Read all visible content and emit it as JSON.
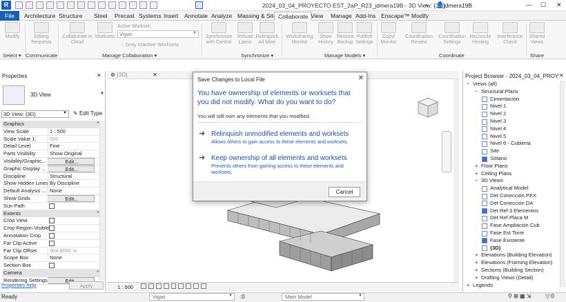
{
  "title_bar": {
    "app_letter": "R",
    "title": "2024_03_04_PROYECTO EST_2aP_R23_jdmera19B - 3D View: {3D}",
    "user": "jdmera19B",
    "minimize": "—",
    "maximize": "☐",
    "close": "✕"
  },
  "menu": {
    "file": "File",
    "tabs": [
      "Architecture",
      "Structure",
      "Steel",
      "Precast",
      "Systems",
      "Insert",
      "Annotate",
      "Analyze",
      "Massing & Site",
      "Collaborate",
      "View",
      "Manage",
      "Add-Ins",
      "Enscape™",
      "Modify"
    ],
    "active_tab": "Collaborate"
  },
  "ribbon": {
    "modify": "Modify",
    "editing_requests": "Editing\nRequests",
    "collab_cloud": "Collaborate in\nCloud",
    "worksets": "Worksets",
    "active_workset_label": "Active Workset:",
    "active_workset_value": "Vigas",
    "gray_inactive": "Gray Inactive Worksets",
    "sync_central": "Synchronize\nwith Central",
    "reload_latest": "Reload\nLatest",
    "relinquish_all": "Relinquish\nAll Mine",
    "worksharing_monitor": "Worksharing\nMonitor",
    "show_history": "Show\nHistory",
    "restore_backup": "Restore\nBackup",
    "publish_settings": "Publish\nSettings",
    "copy_monitor": "Copy/\nMonitor",
    "coordination_review": "Coordination\nReview",
    "coordination_settings": "Coordination\nSettings",
    "reconcile_hosting": "Reconcile\nHosting",
    "interference_check": "Interference\nCheck",
    "shared_views": "Shared\nViews",
    "groups": [
      "Select ▾",
      "Communicate",
      "Manage Collaboration ▾",
      "Synchronize ▾",
      "Manage Models ▾",
      "Coordinate",
      "Share"
    ]
  },
  "properties": {
    "header": "Properties",
    "type_name": "3D View",
    "view_selector": "3D View: {3D}",
    "edit_type": "Edit Type",
    "rows": [
      {
        "k": "Graphics",
        "cat": true
      },
      {
        "k": "View Scale",
        "v": "1 : 500"
      },
      {
        "k": "Scale Value 1:",
        "v": "500",
        "gray": true
      },
      {
        "k": "Detail Level",
        "v": "Fine"
      },
      {
        "k": "Parts Visibility",
        "v": "Show Original"
      },
      {
        "k": "Visibility/Graphic...",
        "v": "Edit...",
        "btn": true
      },
      {
        "k": "Graphic Display ...",
        "v": "Edit...",
        "btn": true
      },
      {
        "k": "Discipline",
        "v": "Structural"
      },
      {
        "k": "Show Hidden Lines",
        "v": "By Discipline"
      },
      {
        "k": "Default Analysis ...",
        "v": "None"
      },
      {
        "k": "Show Grids",
        "v": "Edit...",
        "btn": true
      },
      {
        "k": "Sun Path",
        "check": true
      },
      {
        "k": "Extents",
        "cat": true
      },
      {
        "k": "Crop View",
        "check": true
      },
      {
        "k": "Crop Region Visible",
        "check": true
      },
      {
        "k": "Annotation Crop",
        "check": true
      },
      {
        "k": "Far Clip Active",
        "check": true
      },
      {
        "k": "Far Clip Offset",
        "v": "304.8000 m",
        "gray": true
      },
      {
        "k": "Scope Box",
        "v": "None"
      },
      {
        "k": "Section Box",
        "check": true
      },
      {
        "k": "Camera",
        "cat": true
      },
      {
        "k": "Rendering Settings",
        "v": "Edit...",
        "btn": true
      }
    ],
    "help_link": "Properties help",
    "apply": "Apply"
  },
  "view": {
    "tab_label": "{3D}",
    "scale": "1 : 500"
  },
  "browser": {
    "header": "Project Browser - 2024_03_04_PROYECTO EST...",
    "items": [
      {
        "t": "Views (all)",
        "lvl": 0,
        "exp": "−"
      },
      {
        "t": "Structural Plans",
        "lvl": 1,
        "exp": "−"
      },
      {
        "t": "Cimentación",
        "lvl": 2
      },
      {
        "t": "Nivel 1",
        "lvl": 2
      },
      {
        "t": "Nivel 2",
        "lvl": 2
      },
      {
        "t": "Nivel 3",
        "lvl": 2
      },
      {
        "t": "Nivel 4",
        "lvl": 2
      },
      {
        "t": "Nivel 5",
        "lvl": 2
      },
      {
        "t": "Nivel 6 - Cubierta",
        "lvl": 2
      },
      {
        "t": "Site",
        "lvl": 2
      },
      {
        "t": "Sótano",
        "lvl": 2,
        "on": true
      },
      {
        "t": "Floor Plans",
        "lvl": 1,
        "exp": "+"
      },
      {
        "t": "Ceiling Plans",
        "lvl": 1,
        "exp": "+"
      },
      {
        "t": "3D Views",
        "lvl": 1,
        "exp": "−"
      },
      {
        "t": "Analytical Model",
        "lvl": 2
      },
      {
        "t": "Det Conección PEX",
        "lvl": 2
      },
      {
        "t": "Det Conección DA",
        "lvl": 2
      },
      {
        "t": "Det Ref 3 Elementos",
        "lvl": 2,
        "on": true
      },
      {
        "t": "Det Ref Placa M",
        "lvl": 2
      },
      {
        "t": "Fase Ampliación Cub",
        "lvl": 2
      },
      {
        "t": "Fase Est Torre",
        "lvl": 2
      },
      {
        "t": "Fase Existente",
        "lvl": 2,
        "on": true
      },
      {
        "t": "{3D}",
        "lvl": 2,
        "bold": true
      },
      {
        "t": "Elevations (Building Elevation)",
        "lvl": 1,
        "exp": "+"
      },
      {
        "t": "Elevations (Framing Elevation)",
        "lvl": 1,
        "exp": "+"
      },
      {
        "t": "Sections (Building Section)",
        "lvl": 1,
        "exp": "+"
      },
      {
        "t": "Drafting Views (Detail)",
        "lvl": 1,
        "exp": "+"
      },
      {
        "t": "Legends",
        "lvl": 0,
        "exp": "+"
      }
    ]
  },
  "status": {
    "ready": "Ready",
    "workset": "Vigas",
    "zero": ":0",
    "model": "Main Model"
  },
  "dialog": {
    "title": "Save Changes to Local File",
    "heading": "You have ownership of elements or worksets that you did not modify. What do you want to do?",
    "note": "You will still own any elements that you modified.",
    "options": [
      {
        "title": "Relinquish unmodified elements and worksets",
        "desc": "Allows others to gain access to these elements and worksets."
      },
      {
        "title": "Keep ownership of all elements and worksets",
        "desc": "Prevents others from gaining access to these elements and worksets."
      }
    ],
    "cancel": "Cancel"
  },
  "colors": {
    "accent": "#1e4fa5",
    "file_tab": "#1760b5"
  }
}
